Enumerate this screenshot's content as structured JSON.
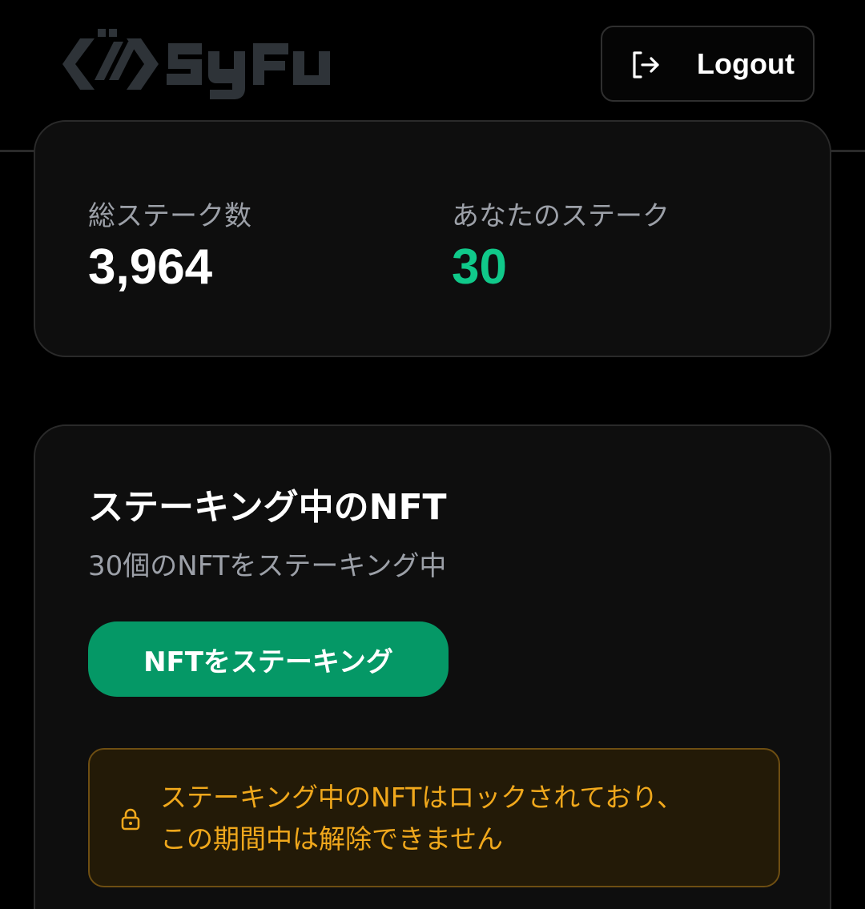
{
  "header": {
    "brand": "Syfu",
    "logout_label": "Logout",
    "logout_icon": "logout-icon"
  },
  "stats": {
    "total_label": "総ステーク数",
    "total_value": "3,964",
    "yours_label": "あなたのステーク",
    "yours_value": "30"
  },
  "nft_section": {
    "title": "ステーキング中のNFT",
    "subtitle": "30個のNFTをステーキング中",
    "stake_button_label": "NFTをステーキング",
    "notice_line1": "ステーキング中のNFTはロックされており、",
    "notice_line2": "この期間中は解除できません",
    "notice_icon": "lock-icon"
  },
  "colors": {
    "accent_green": "#059866",
    "value_green": "#10c98a",
    "notice_amber": "#f0a81c",
    "logo_gray": "#2e3338"
  }
}
